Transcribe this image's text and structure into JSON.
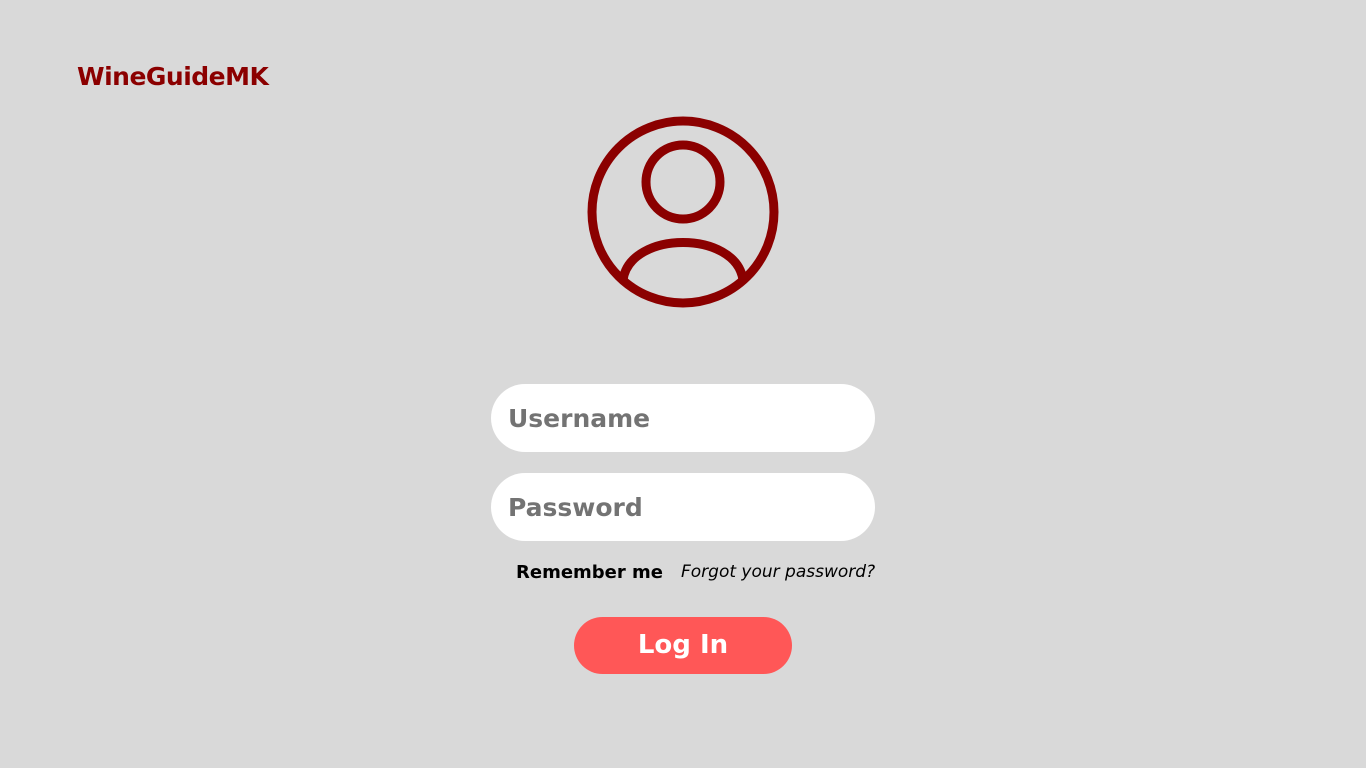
{
  "app": {
    "brand": "WineGuideMK"
  },
  "login": {
    "avatar_icon": "user-circle-icon",
    "username_placeholder": "Username",
    "username_value": "",
    "password_placeholder": "Password",
    "password_value": "",
    "remember_label": "Remember me",
    "forgot_label": "Forgot your password?",
    "submit_label": "Log In"
  },
  "colors": {
    "brand": "#8b0000",
    "background": "#d9d9d9",
    "button": "#ff5757",
    "field": "#ffffff"
  }
}
